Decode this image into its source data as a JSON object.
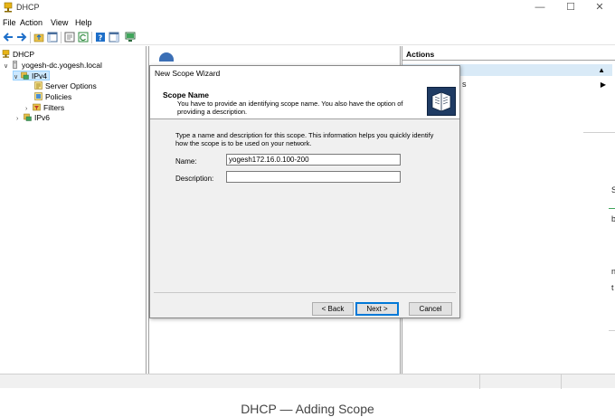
{
  "window": {
    "title": "DHCP",
    "minimize_glyph": "—",
    "maximize_glyph": "☐",
    "close_glyph": "✕"
  },
  "menu": {
    "items": [
      "File",
      "Action",
      "View",
      "Help"
    ]
  },
  "toolbar": {
    "icons": [
      "back-arrow-icon",
      "forward-arrow-icon",
      "up-folder-icon",
      "show-hide-tree-icon",
      "properties-icon",
      "refresh-icon",
      "help-icon",
      "show-action-pane-icon",
      "monitor-icon"
    ]
  },
  "tree": {
    "root": "DHCP",
    "server": "yogesh-dc.yogesh.local",
    "ipv4": "IPv4",
    "server_options": "Server Options",
    "policies": "Policies",
    "filters": "Filters",
    "ipv6": "IPv6"
  },
  "actions": {
    "header": "Actions",
    "fragment_s": "s",
    "fragment_S": "S",
    "fragment_b": "b",
    "fragment_n": "n",
    "fragment_t": "t"
  },
  "wizard": {
    "title": "New Scope Wizard",
    "heading": "Scope Name",
    "subheading": "You have to provide an identifying scope name. You also have the option of providing a description.",
    "body": "Type a name and description for this scope. This information helps you quickly identify how the scope is to be used on your network.",
    "name_label": "Name:",
    "name_value": "yogesh172.16.0.100-200",
    "description_label": "Description:",
    "description_value": "",
    "back_button": "< Back",
    "next_button": "Next >",
    "cancel_button": "Cancel"
  },
  "caption": "DHCP — Adding Scope",
  "colors": {
    "selection": "#cce8ff",
    "actions_band": "#d9eaf7",
    "default_button_border": "#0078d7"
  }
}
